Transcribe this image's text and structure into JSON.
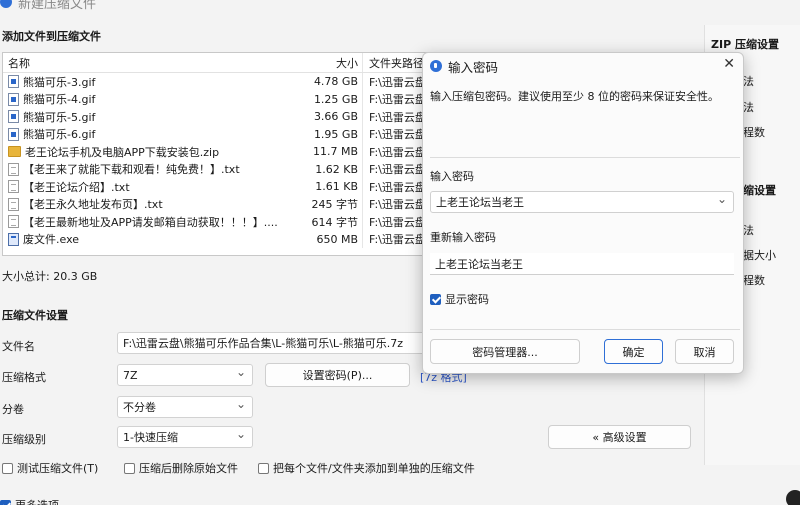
{
  "window": {
    "title": "新建压缩文件"
  },
  "add_files": {
    "section_title": "添加文件到压缩文件",
    "columns": {
      "name": "名称",
      "size": "大小",
      "path": "文件夹路径"
    },
    "rows": [
      {
        "icon": "gif",
        "name": "熊猫可乐-3.gif",
        "size": "4.78 GB",
        "path": "F:\\迅雷云盘"
      },
      {
        "icon": "gif",
        "name": "熊猫可乐-4.gif",
        "size": "1.25 GB",
        "path": "F:\\迅雷云盘"
      },
      {
        "icon": "gif",
        "name": "熊猫可乐-5.gif",
        "size": "3.66 GB",
        "path": "F:\\迅雷云盘"
      },
      {
        "icon": "gif",
        "name": "熊猫可乐-6.gif",
        "size": "1.95 GB",
        "path": "F:\\迅雷云盘"
      },
      {
        "icon": "zip",
        "name": "老王论坛手机及电脑APP下载安装包.zip",
        "size": "11.7 MB",
        "path": "F:\\迅雷云盘"
      },
      {
        "icon": "txt",
        "name": "【老王来了就能下载和观看！纯免费！】.txt",
        "size": "1.62 KB",
        "path": "F:\\迅雷云盘"
      },
      {
        "icon": "txt",
        "name": "【老王论坛介绍】.txt",
        "size": "1.61 KB",
        "path": "F:\\迅雷云盘"
      },
      {
        "icon": "txt",
        "name": "【老王永久地址发布页】.txt",
        "size": "245 字节",
        "path": "F:\\迅雷云盘"
      },
      {
        "icon": "txt",
        "name": "【老王最新地址及APP请发邮箱自动获取！！！】....",
        "size": "614 字节",
        "path": "F:\\迅雷云盘"
      },
      {
        "icon": "exe",
        "name": "废文件.exe",
        "size": "650 MB",
        "path": "F:\\迅雷云盘"
      }
    ],
    "total_label": "大小总计: 20.3 GB"
  },
  "settings": {
    "section_title": "压缩文件设置",
    "filename_label": "文件名",
    "filename_value": "F:\\迅雷云盘\\熊猫可乐作品合集\\L-熊猫可乐\\L-熊猫可乐.7z",
    "format_label": "压缩格式",
    "format_value": "7Z",
    "set_password_button": "设置密码(P)...",
    "format_link": "[7z 格式]",
    "split_label": "分卷",
    "split_value": "不分卷",
    "level_label": "压缩级别",
    "level_value": "1-快速压缩",
    "advanced_button": "« 高级设置",
    "options": [
      {
        "label": "测试压缩文件(T)",
        "checked": false
      },
      {
        "label": "压缩后删除原始文件",
        "checked": false
      },
      {
        "label": "把每个文件/文件夹添加到单独的压缩文件",
        "checked": false
      }
    ],
    "more_options": "更多选项"
  },
  "right_panel": {
    "zip_title": "ZIP 压缩设置",
    "items": [
      "法",
      "法",
      "程数",
      "缩设置",
      "法",
      "据大小",
      "程数"
    ]
  },
  "dialog": {
    "title": "输入密码",
    "hint": "输入压缩包密码。建议使用至少 8 位的密码来保证安全性。",
    "password_label": "输入密码",
    "password_value": "上老王论坛当老王",
    "confirm_label": "重新输入密码",
    "confirm_value": "上老王论坛当老王",
    "show_password_label": "显示密码",
    "show_password_checked": true,
    "manager_button": "密码管理器...",
    "ok_button": "确定",
    "cancel_button": "取消"
  }
}
